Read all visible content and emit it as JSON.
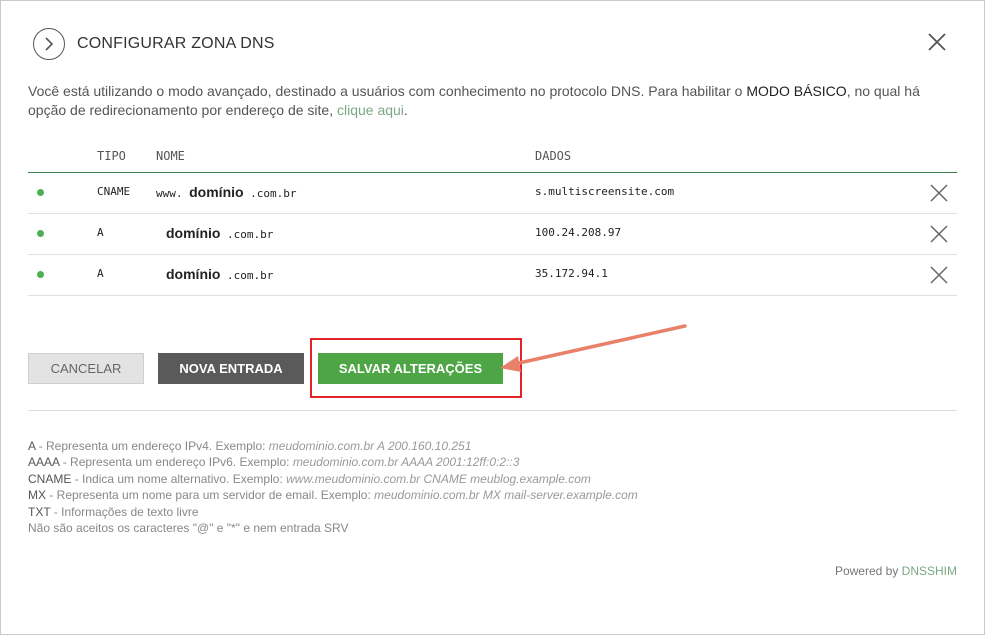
{
  "dialog": {
    "title": "CONFIGURAR ZONA DNS",
    "intro": {
      "part1": "Você está utilizando o modo avançado, destinado a usuários com conhecimento no protocolo DNS. Para habilitar o ",
      "bold": "MODO BÁSICO",
      "part2": ", no qual há opção de redirecionamento por endereço de site, ",
      "link": "clique aqui",
      "end": "."
    }
  },
  "table": {
    "headers": {
      "tipo": "TIPO",
      "nome": "NOME",
      "dados": "DADOS"
    },
    "rows": [
      {
        "tipo": "CNAME",
        "prefix": "www. ",
        "domain": "domínio",
        "suffix": " .com.br",
        "dados": "s.multiscreensite.com"
      },
      {
        "tipo": "A",
        "prefix": "",
        "domain": "domínio",
        "suffix": " .com.br",
        "dados": "100.24.208.97"
      },
      {
        "tipo": "A",
        "prefix": "",
        "domain": "domínio",
        "suffix": " .com.br",
        "dados": "35.172.94.1"
      }
    ]
  },
  "buttons": {
    "cancel": "CANCELAR",
    "new_entry": "NOVA ENTRADA",
    "save": "SALVAR ALTERAÇÕES"
  },
  "legend": [
    {
      "key": "A",
      "desc": " - Representa um endereço IPv4. Exemplo: ",
      "example": "meudominio.com.br A 200.160.10.251"
    },
    {
      "key": "AAAA",
      "desc": " - Representa um endereço IPv6. Exemplo: ",
      "example": "meudominio.com.br AAAA 2001:12ff:0:2::3"
    },
    {
      "key": "CNAME",
      "desc": " - Indica um nome alternativo. Exemplo: ",
      "example": "www.meudominio.com.br CNAME meublog.example.com"
    },
    {
      "key": "MX",
      "desc": " - Representa um nome para um servidor de email. Exemplo: ",
      "example": "meudominio.com.br MX mail-server.example.com"
    },
    {
      "key": "TXT",
      "desc": " - Informações de texto livre",
      "example": ""
    }
  ],
  "legend_note": "Não são aceitos os caracteres \"@\" e \"*\" e nem entrada SRV",
  "footer": {
    "powered_by": "Powered by ",
    "brand": "DNSSHIM"
  },
  "colors": {
    "accent_green": "#4ea546",
    "highlight_red": "#e0242a",
    "arrow": "#e8806a",
    "link": "#7aa883"
  },
  "icons": {
    "header": "chevron-right-circle-icon",
    "close": "close-icon",
    "row_status": "status-dot-icon",
    "row_delete": "delete-x-icon"
  }
}
